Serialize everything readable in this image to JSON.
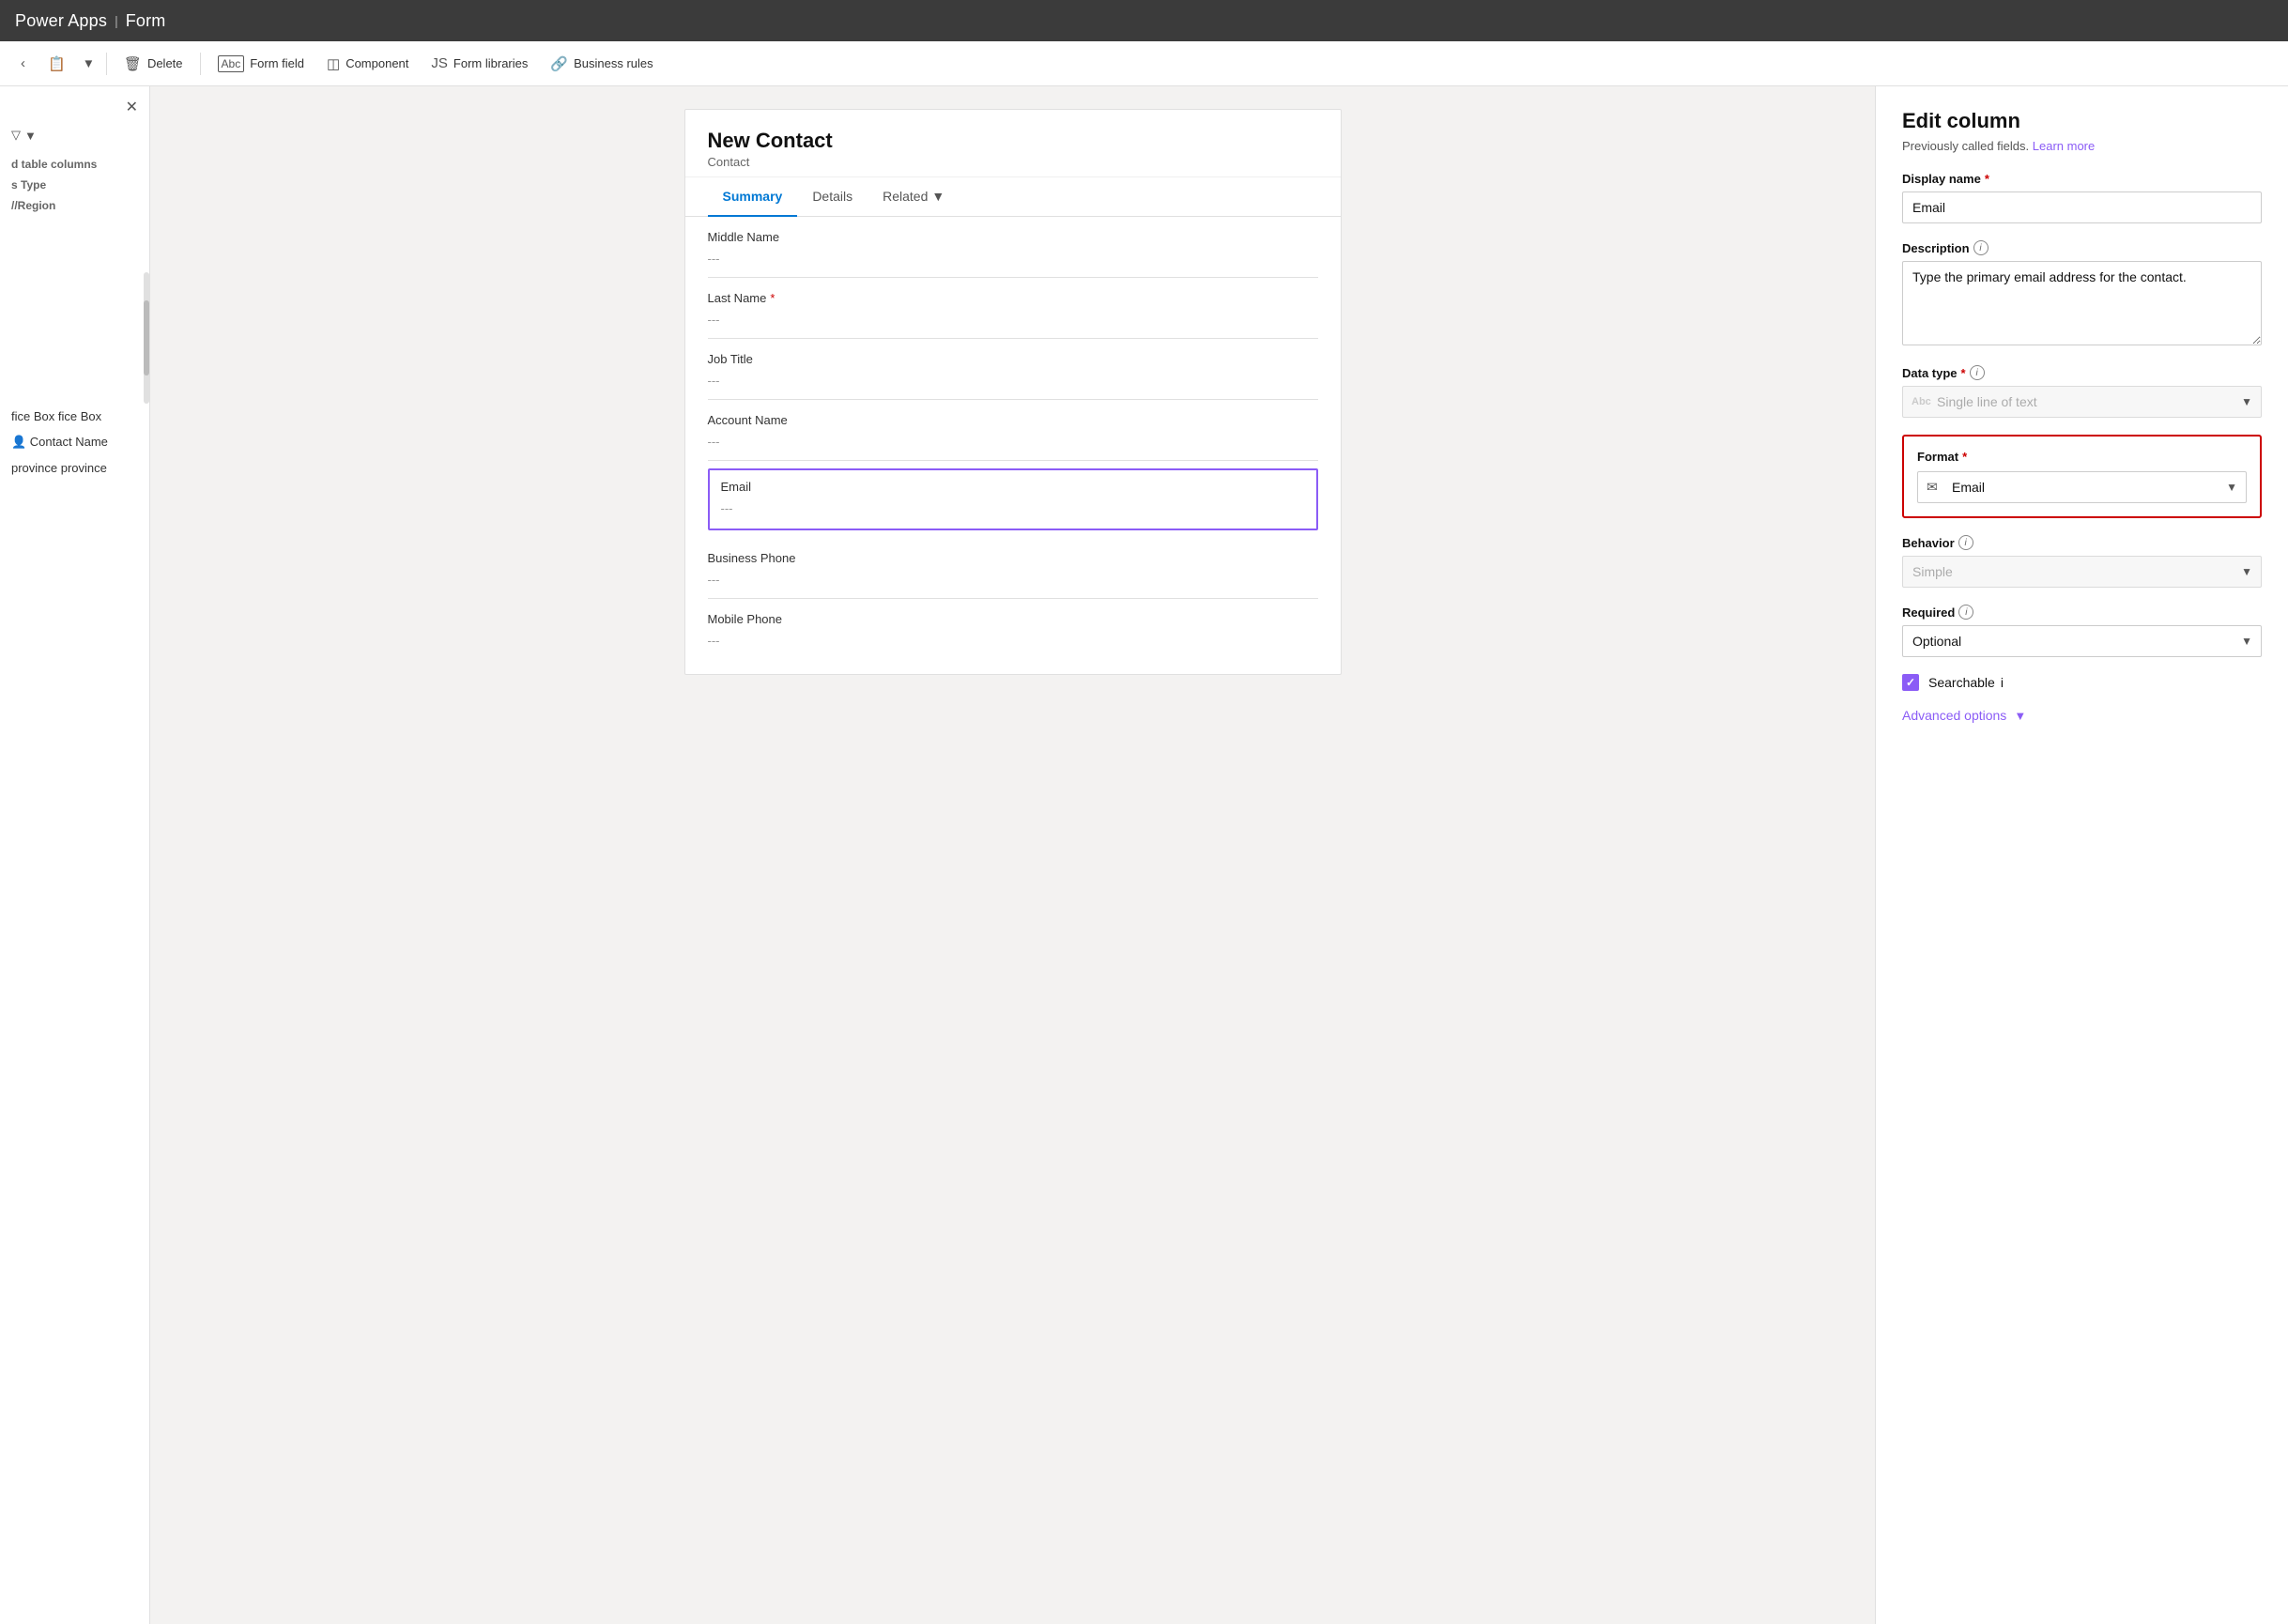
{
  "topbar": {
    "app_name": "Power Apps",
    "separator": "|",
    "section": "Form"
  },
  "toolbar": {
    "delete_label": "Delete",
    "form_field_label": "Form field",
    "component_label": "Component",
    "form_libraries_label": "Form libraries",
    "business_rules_label": "Business rules",
    "dropdown_icon": "▾"
  },
  "sidebar": {
    "close_icon": "✕",
    "filter_icon": "⊽",
    "filter_dropdown": "▾",
    "section_label_columns": "d table columns",
    "section_label_type": "s Type",
    "section_label_region": "//Region",
    "items": [
      {
        "label": ""
      },
      {
        "label": ""
      },
      {
        "label": "fice Box"
      },
      {
        "label": "Contact Name"
      },
      {
        "label": "province"
      }
    ]
  },
  "form": {
    "title": "New Contact",
    "subtitle": "Contact",
    "tabs": [
      {
        "label": "Summary",
        "active": true
      },
      {
        "label": "Details",
        "active": false
      },
      {
        "label": "Related",
        "active": false
      }
    ],
    "fields": [
      {
        "label": "Middle Name",
        "value": "---",
        "required": false
      },
      {
        "label": "Last Name",
        "value": "---",
        "required": true
      },
      {
        "label": "Job Title",
        "value": "---",
        "required": false
      },
      {
        "label": "Account Name",
        "value": "---",
        "required": false
      },
      {
        "label": "Email",
        "value": "---",
        "required": false,
        "selected": true
      },
      {
        "label": "Business Phone",
        "value": "---",
        "required": false
      },
      {
        "label": "Mobile Phone",
        "value": "---",
        "required": false
      }
    ]
  },
  "panel": {
    "title": "Edit column",
    "subtitle": "Previously called fields.",
    "learn_more": "Learn more",
    "display_name_label": "Display name",
    "display_name_required": true,
    "display_name_value": "Email",
    "description_label": "Description",
    "description_info": true,
    "description_value": "Type the primary email address for the contact.",
    "data_type_label": "Data type",
    "data_type_required": true,
    "data_type_info": true,
    "data_type_prefix": "Abc",
    "data_type_value": "Single line of text",
    "format_label": "Format",
    "format_required": true,
    "format_icon": "✉",
    "format_value": "Email",
    "behavior_label": "Behavior",
    "behavior_info": true,
    "behavior_value": "Simple",
    "required_label": "Required",
    "required_info": true,
    "required_value": "Optional",
    "searchable_label": "Searchable",
    "searchable_info": true,
    "searchable_checked": true,
    "advanced_options_label": "Advanced options"
  }
}
